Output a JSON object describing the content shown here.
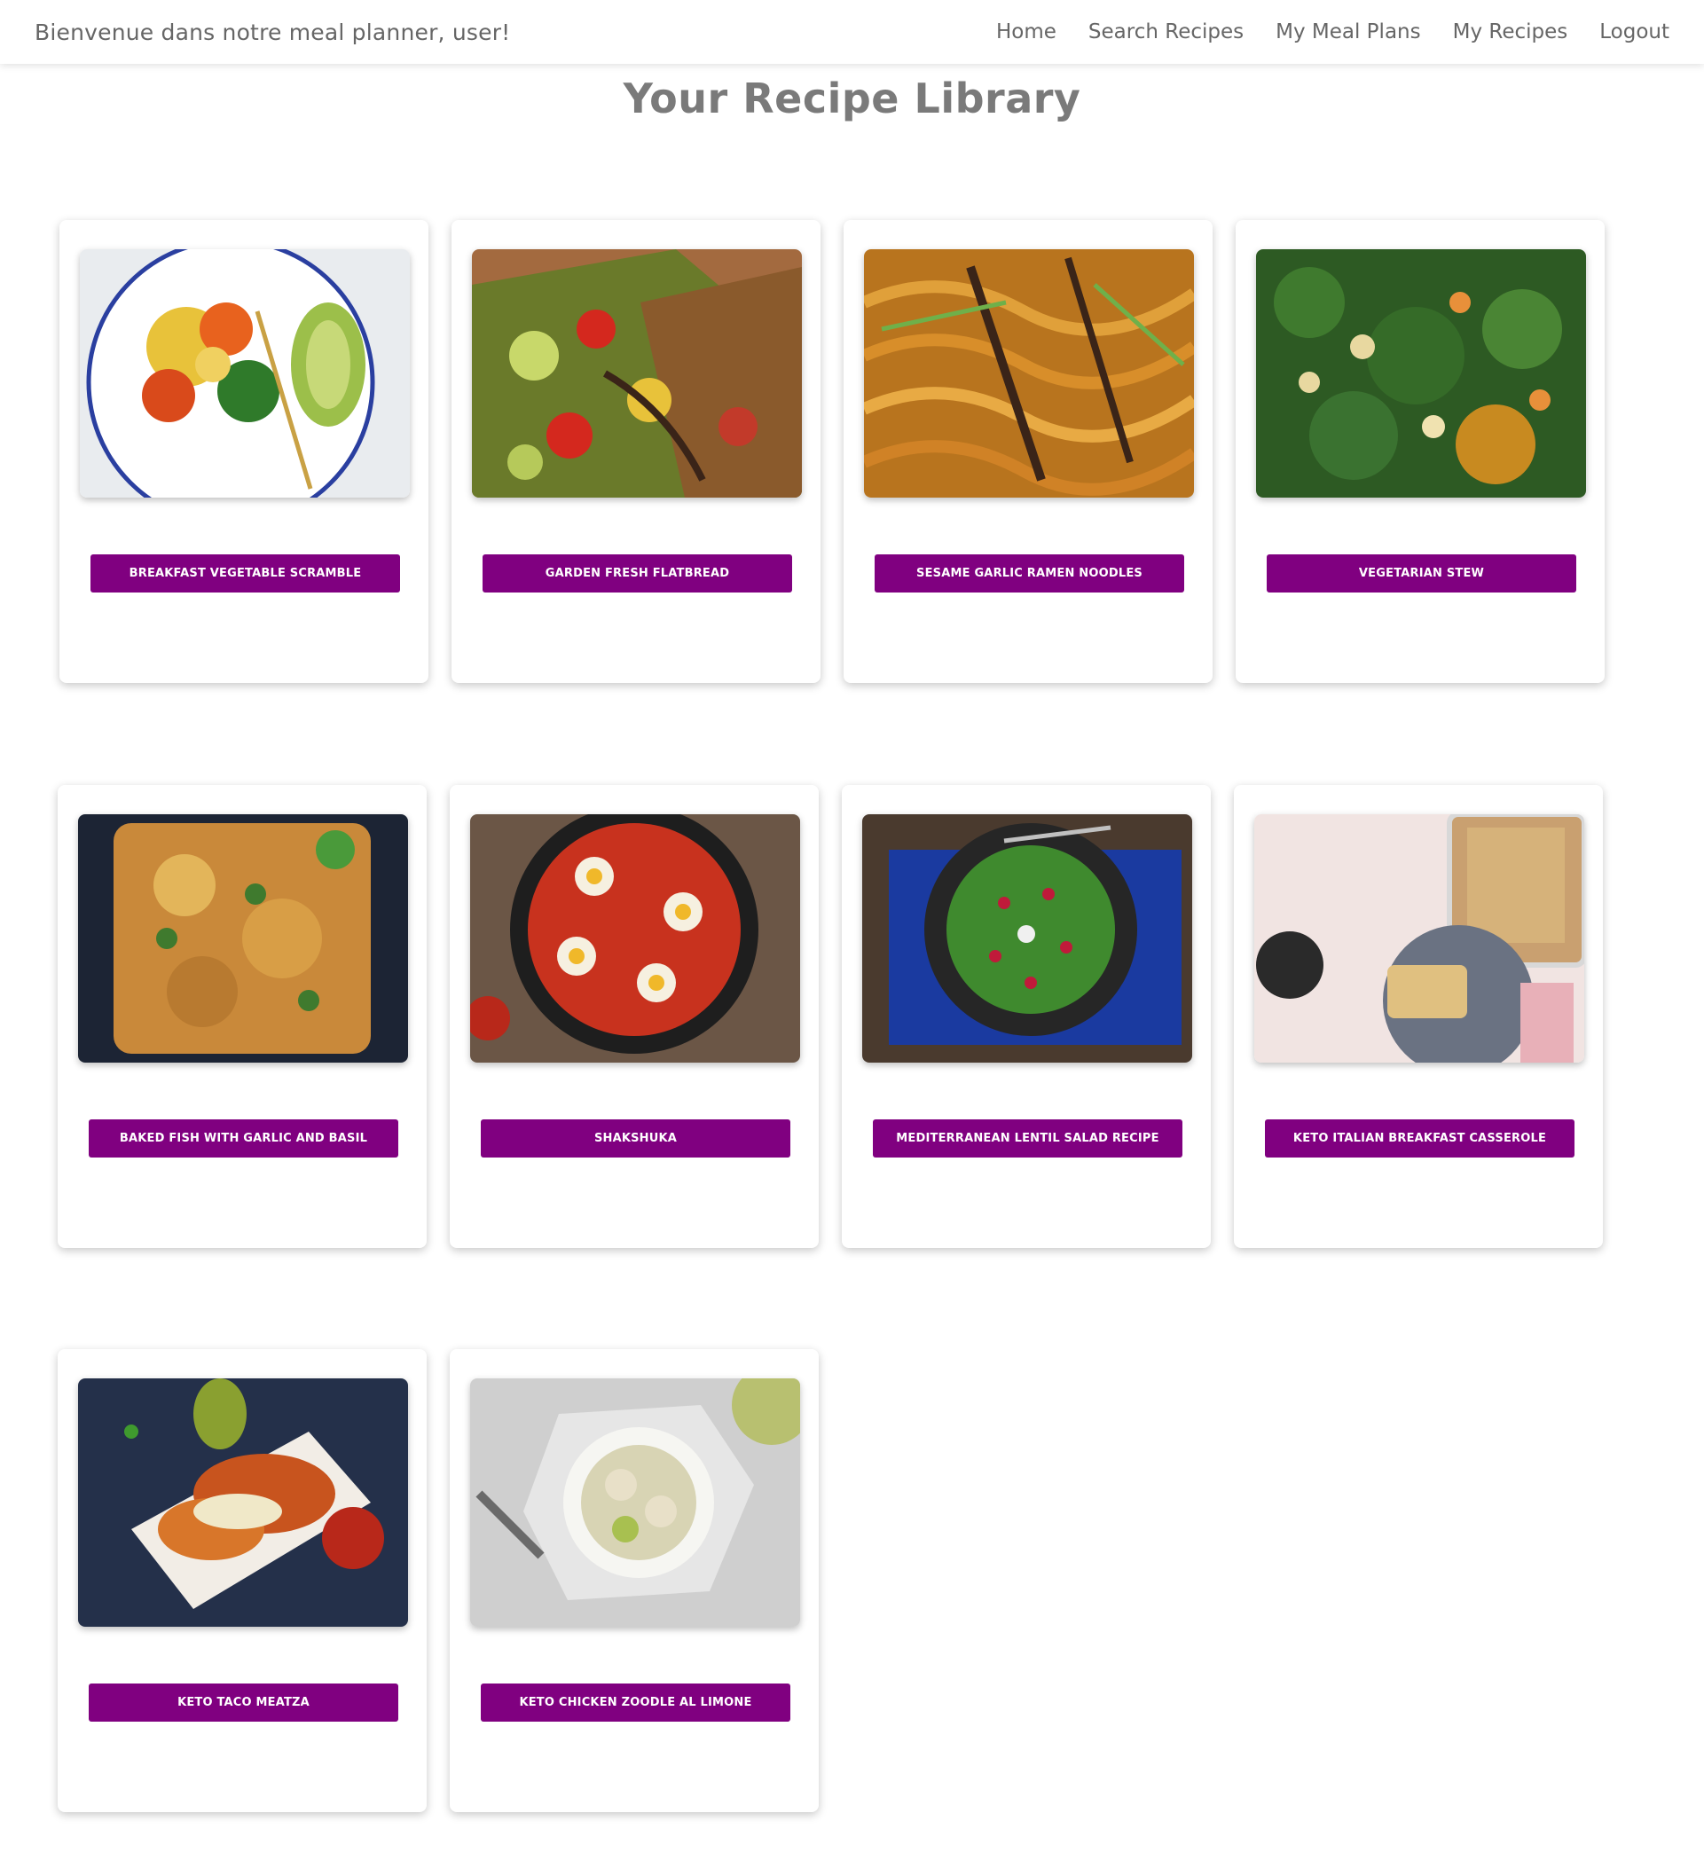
{
  "navbar": {
    "brand": "Bienvenue dans notre meal planner, user!",
    "links": [
      {
        "label": "Home"
      },
      {
        "label": "Search Recipes"
      },
      {
        "label": "My Meal Plans"
      },
      {
        "label": "My Recipes"
      },
      {
        "label": "Logout"
      }
    ]
  },
  "page": {
    "title": "Your Recipe Library"
  },
  "colors": {
    "accent": "#800080",
    "card_bg": "#ffffff",
    "text_muted": "#7a7a7a"
  },
  "recipes": [
    {
      "title": "BREAKFAST VEGETABLE SCRAMBLE"
    },
    {
      "title": "GARDEN FRESH FLATBREAD"
    },
    {
      "title": "SESAME GARLIC RAMEN NOODLES"
    },
    {
      "title": "VEGETARIAN STEW"
    },
    {
      "title": "BAKED FISH WITH GARLIC AND BASIL"
    },
    {
      "title": "SHAKSHUKA"
    },
    {
      "title": "MEDITERRANEAN LENTIL SALAD RECIPE"
    },
    {
      "title": "KETO ITALIAN BREAKFAST CASSEROLE"
    },
    {
      "title": "KETO TACO MEATZA"
    },
    {
      "title": "KETO CHICKEN ZOODLE AL LIMONE"
    }
  ]
}
